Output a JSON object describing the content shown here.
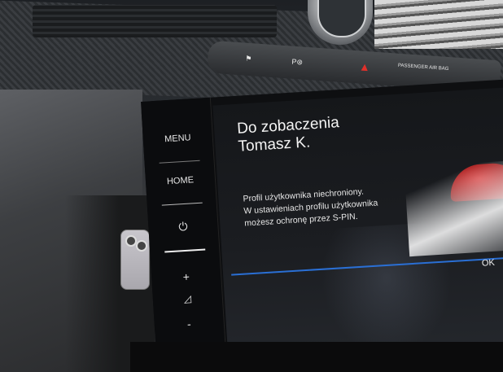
{
  "sidebar": {
    "menu_label": "MENU",
    "home_label": "HOME",
    "power_icon": "⏻",
    "plus_label": "+",
    "volume_icon": "◿",
    "minus_label": "-"
  },
  "greeting": {
    "line1": "Do zobaczenia",
    "line2": "Tomasz K."
  },
  "message": {
    "line1": "Profil użytkownika niechroniony.",
    "line2": "W ustawieniach profilu użytkownika",
    "line3": "możesz ochronę przez S-PIN."
  },
  "ok_label": "OK",
  "dash_buttons": {
    "b1": "⚑",
    "b2": "P⊛",
    "hazard": "▲",
    "b4": "PASSENGER AIR BAG"
  },
  "colors": {
    "accent": "#2a6fd4",
    "hazard": "#e0302a"
  }
}
